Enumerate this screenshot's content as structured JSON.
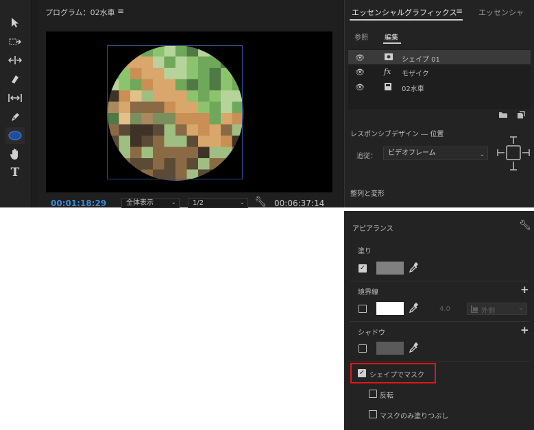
{
  "tools": [
    {
      "name": "selection-tool-icon",
      "glyph": "▲"
    },
    {
      "name": "track-select-tool-icon",
      "glyph": "⇢"
    },
    {
      "name": "ripple-edit-tool-icon",
      "glyph": "⇹"
    },
    {
      "name": "razor-tool-icon",
      "glyph": "◆"
    },
    {
      "name": "slip-tool-icon",
      "glyph": "↔"
    },
    {
      "name": "pen-tool-icon",
      "glyph": "✎"
    },
    {
      "name": "ellipse-tool-icon",
      "glyph": "⬬"
    },
    {
      "name": "hand-tool-icon",
      "glyph": "✋"
    },
    {
      "name": "type-tool-icon",
      "glyph": "T"
    }
  ],
  "monitor": {
    "title": "プログラム：02水車",
    "menu_icon": "≡",
    "timecode": "00:01:18:29",
    "fit_label": "全体表示",
    "resolution_label": "1/2",
    "duration": "00:06:37:14"
  },
  "essential_graphics": {
    "tab_label": "エッセンシャルグラフィックス",
    "menu_icon": "≡",
    "tab2_label": "エッセンシャ",
    "browse_tab": "参照",
    "edit_tab": "編集",
    "layers": [
      {
        "name": "シェイプ 01",
        "icon": "▣",
        "selected": true
      },
      {
        "name": "モザイク",
        "icon": "fx",
        "selected": false
      },
      {
        "name": "02水車",
        "icon": "▤",
        "selected": false
      }
    ],
    "responsive_title": "レスポンシブデザイン ― 位置",
    "follow_label": "追従：",
    "follow_value": "ビデオフレーム",
    "align_title": "整列と変形"
  },
  "appearance": {
    "title": "アピアランス",
    "fill_label": "塗り",
    "fill_checked": true,
    "fill_color": "#808080",
    "stroke_label": "境界線",
    "stroke_checked": false,
    "stroke_color": "#ffffff",
    "stroke_width": "4.0",
    "stroke_position": "外側",
    "shadow_label": "シャドウ",
    "shadow_checked": false,
    "shadow_color": "#5a5a5a",
    "mask_label": "シェイプでマスク",
    "mask_checked": true,
    "invert_label": "反転",
    "invert_checked": false,
    "mask_fill_only_label": "マスクのみ塗りつぶし",
    "mask_fill_only_checked": false
  },
  "colors": {
    "timecode": "#3d8bd9",
    "highlight": "#e8141b",
    "selection_box": "#2d4f8c"
  }
}
